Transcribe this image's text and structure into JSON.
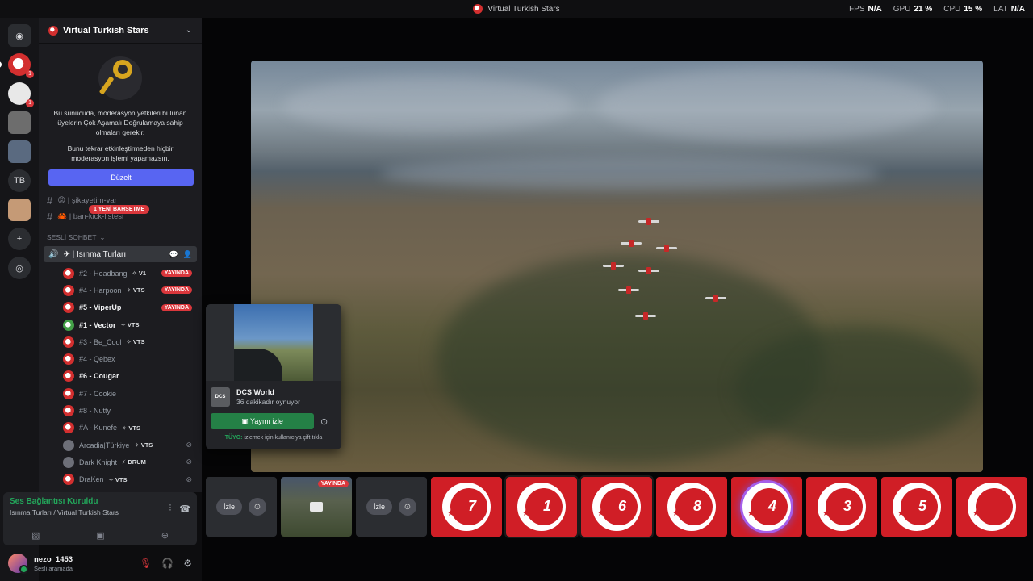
{
  "window": {
    "title": "Virtual Turkish Stars",
    "perf": [
      {
        "label": "FPS",
        "value": "N/A"
      },
      {
        "label": "GPU",
        "value": "21 %"
      },
      {
        "label": "CPU",
        "value": "15 %"
      },
      {
        "label": "LAT",
        "value": "N/A"
      }
    ]
  },
  "rail": {
    "items": [
      {
        "icon": "discord-icon",
        "badge": ""
      },
      {
        "icon": "server-vts-icon",
        "badge": "1"
      },
      {
        "icon": "server-icon",
        "badge": "1"
      },
      {
        "icon": "server-icon",
        "badge": ""
      },
      {
        "icon": "server-icon",
        "badge": ""
      },
      {
        "icon": "server-tb",
        "text": "TB"
      },
      {
        "icon": "server-icon",
        "badge": ""
      },
      {
        "icon": "add-server-icon",
        "text": "+"
      },
      {
        "icon": "explore-icon",
        "text": "◎"
      }
    ]
  },
  "server": {
    "name": "Virtual Turkish Stars"
  },
  "mfa": {
    "text1": "Bu sunucuda, moderasyon yetkileri bulunan üyelerin Çok Aşamalı Doğrulamaya sahip olmaları gerekir.",
    "text2": "Bunu tekrar etkinleştirmeden hiçbir moderasyon işlemi yapamazsın.",
    "button": "Düzelt"
  },
  "channels": [
    {
      "name": "😡 | şikayetim-var"
    },
    {
      "name": "🦀 | ban-kick-listesi"
    }
  ],
  "mention_pill": "1 YENİ BAHSETME",
  "voice_category": "SESLİ SOHBET",
  "voice_channel": {
    "name": "✈ | Isınma Turları"
  },
  "members": [
    {
      "name": "#2 - Headbang",
      "tag": "✧ V1",
      "live": "YAYINDA",
      "bright": false,
      "av": "r"
    },
    {
      "name": "#4 - Harpoon",
      "tag": "✧ VTS",
      "live": "YAYINDA",
      "bright": false,
      "av": "r"
    },
    {
      "name": "#5 - ViperUp",
      "tag": "",
      "live": "YAYINDA",
      "bright": true,
      "av": "r"
    },
    {
      "name": "#1 - Vector",
      "tag": "✧ VTS",
      "live": "",
      "bright": true,
      "av": "g"
    },
    {
      "name": "#3 - Be_Cool",
      "tag": "✧ VTS",
      "live": "",
      "bright": false,
      "av": "r"
    },
    {
      "name": "#4 - Qebex",
      "tag": "",
      "live": "",
      "bright": false,
      "av": "r"
    },
    {
      "name": "#6 - Cougar",
      "tag": "",
      "live": "",
      "bright": true,
      "av": "r"
    },
    {
      "name": "#7 - Cookie",
      "tag": "",
      "live": "",
      "bright": false,
      "av": "r"
    },
    {
      "name": "#8 - Nutty",
      "tag": "",
      "live": "",
      "bright": false,
      "av": "r"
    },
    {
      "name": "#A - Kunefe",
      "tag": "✧ VTS",
      "live": "",
      "bright": false,
      "av": "r"
    },
    {
      "name": "Arcadia|Türkiye",
      "tag": "✧ VTS",
      "live": "",
      "bright": false,
      "av": "p",
      "muted": true
    },
    {
      "name": "Dark Knight",
      "tag": "⚡ DRUM",
      "live": "",
      "bright": false,
      "av": "p",
      "muted": true
    },
    {
      "name": "DraKen",
      "tag": "✧ VTS",
      "live": "",
      "bright": false,
      "av": "r",
      "muted": true
    }
  ],
  "voice_panel": {
    "status": "Ses Bağlantısı Kuruldu",
    "location": "Isınma Turları / Virtual Turkish Stars"
  },
  "user": {
    "name": "nezo_1453",
    "status": "Sesli aramada"
  },
  "hover_card": {
    "game": "DCS World",
    "game_icon": "DCS",
    "playing": "36 dakikadır oynuyor",
    "watch": "Yayını izle",
    "tip_label": "TÜYO:",
    "tip": "izlemek için kullanıcıya çift tıkla"
  },
  "tiles": {
    "watch_label_1": "İzle",
    "watch_label_2": "İzle",
    "live_badge": "YAYINDA",
    "numbers": [
      "7",
      "1",
      "6",
      "8",
      "4",
      "3",
      "5"
    ]
  }
}
